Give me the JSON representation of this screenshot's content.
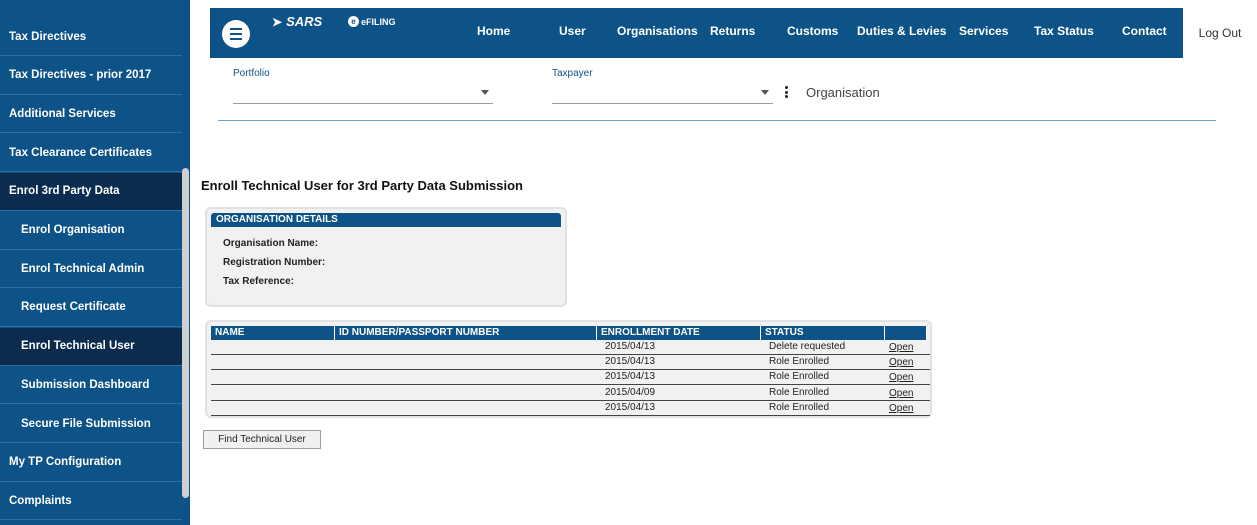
{
  "sidebar": {
    "items": [
      {
        "label": "Tax Directives",
        "sub": false,
        "active": false
      },
      {
        "label": "Tax Directives - prior 2017",
        "sub": false,
        "active": false
      },
      {
        "label": "Additional Services",
        "sub": false,
        "active": false
      },
      {
        "label": "Tax Clearance Certificates",
        "sub": false,
        "active": false
      },
      {
        "label": "Enrol 3rd Party Data",
        "sub": false,
        "active": true
      },
      {
        "label": "Enrol Organisation",
        "sub": true,
        "active": false
      },
      {
        "label": "Enrol Technical Admin",
        "sub": true,
        "active": false
      },
      {
        "label": "Request Certificate",
        "sub": true,
        "active": false
      },
      {
        "label": "Enrol Technical User",
        "sub": true,
        "active": true
      },
      {
        "label": "Submission Dashboard",
        "sub": true,
        "active": false
      },
      {
        "label": "Secure File Submission",
        "sub": true,
        "active": false
      },
      {
        "label": "My TP Configuration",
        "sub": false,
        "active": false
      },
      {
        "label": "Complaints",
        "sub": false,
        "active": false
      }
    ]
  },
  "header": {
    "logo": "SARS",
    "logo_sub": "eFILING",
    "nav": [
      "Home",
      "User",
      "Organisations",
      "Returns",
      "Customs",
      "Duties & Levies",
      "Services",
      "Tax Status",
      "Contact"
    ],
    "logout": "Log Out"
  },
  "filters": {
    "portfolio_label": "Portfolio",
    "portfolio_value": "",
    "taxpayer_label": "Taxpayer",
    "taxpayer_value": "",
    "organisation_label": "Organisation"
  },
  "page": {
    "title": "Enroll Technical User for 3rd Party Data Submission"
  },
  "org_details": {
    "heading": "ORGANISATION DETAILS",
    "fields": [
      "Organisation Name:",
      "Registration Number:",
      "Tax Reference:"
    ]
  },
  "users_table": {
    "columns": [
      "NAME",
      "ID NUMBER/PASSPORT NUMBER",
      "ENROLLMENT DATE",
      "STATUS",
      ""
    ],
    "rows": [
      {
        "name": "",
        "id_number": "",
        "date": "2015/04/13",
        "status": "Delete requested",
        "action": "Open"
      },
      {
        "name": "",
        "id_number": "",
        "date": "2015/04/13",
        "status": "Role Enrolled",
        "action": "Open"
      },
      {
        "name": "",
        "id_number": "",
        "date": "2015/04/13",
        "status": "Role Enrolled",
        "action": "Open"
      },
      {
        "name": "",
        "id_number": "",
        "date": "2015/04/09",
        "status": "Role Enrolled",
        "action": "Open"
      },
      {
        "name": "",
        "id_number": "",
        "date": "2015/04/13",
        "status": "Role Enrolled",
        "action": "Open"
      }
    ]
  },
  "actions": {
    "find_label": "Find Technical User"
  },
  "colors": {
    "brand": "#0e5387",
    "sidebar_active": "#0b2c4f",
    "panel_bg": "#f1f1f1"
  }
}
